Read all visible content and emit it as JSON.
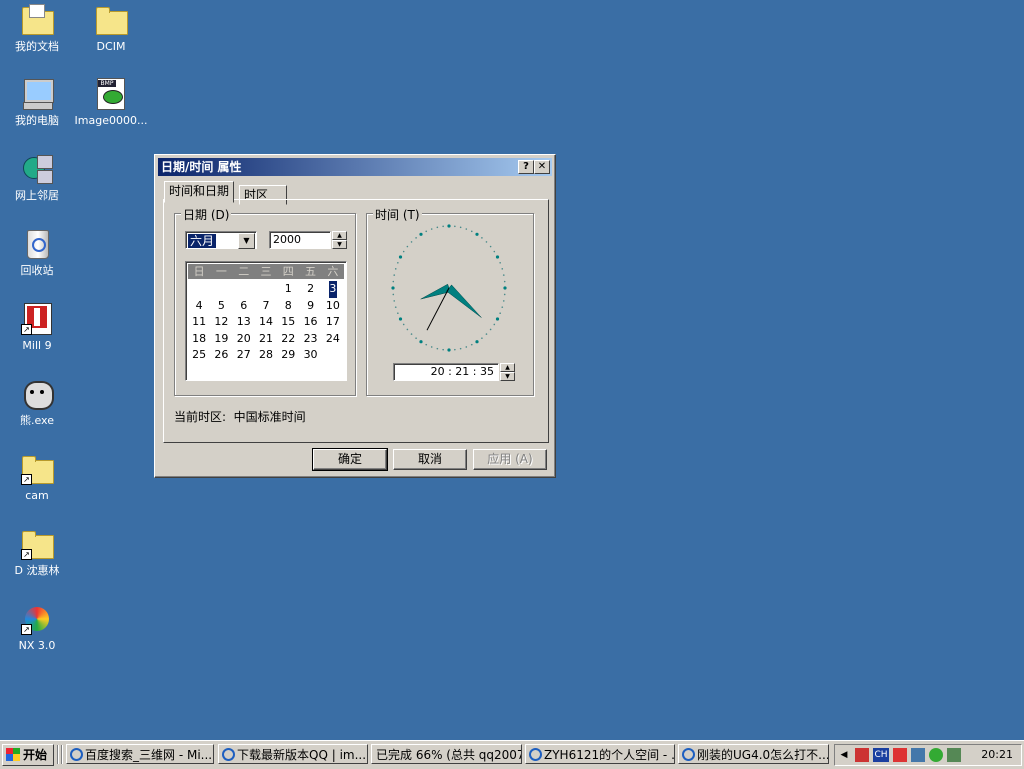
{
  "desktop": {
    "icons": [
      {
        "label": "我的文档",
        "icon": "my-documents-icon"
      },
      {
        "label": "DCIM",
        "icon": "folder-icon"
      },
      {
        "label": "我的电脑",
        "icon": "my-computer-icon"
      },
      {
        "label": "Image0000...",
        "icon": "bmp-image-icon"
      },
      {
        "label": "网上邻居",
        "icon": "network-icon"
      },
      {
        "label": "回收站",
        "icon": "recycle-bin-icon"
      },
      {
        "label": "Mill 9",
        "icon": "mill-app-icon"
      },
      {
        "label": "熊.exe",
        "icon": "bear-exe-icon"
      },
      {
        "label": "cam",
        "icon": "folder-shortcut-icon"
      },
      {
        "label": "D 沈惠林",
        "icon": "folder-shortcut-icon"
      },
      {
        "label": "NX 3.0",
        "icon": "nx-app-icon"
      }
    ]
  },
  "dialog": {
    "title": "日期/时间 属性",
    "help_glyph": "?",
    "close_glyph": "✕",
    "tabs": [
      "时间和日期",
      "时区"
    ],
    "date_group": {
      "label": "日期 (D)",
      "month": "六月",
      "year": "2000",
      "weekdays": [
        "日",
        "一",
        "二",
        "三",
        "四",
        "五",
        "六"
      ],
      "days": [
        "",
        "",
        "",
        "",
        "1",
        "2",
        "3",
        "4",
        "5",
        "6",
        "7",
        "8",
        "9",
        "10",
        "11",
        "12",
        "13",
        "14",
        "15",
        "16",
        "17",
        "18",
        "19",
        "20",
        "21",
        "22",
        "23",
        "24",
        "25",
        "26",
        "27",
        "28",
        "29",
        "30"
      ],
      "selected_day": "3"
    },
    "time_group": {
      "label": "时间 (T)",
      "time": "20 : 21 : 35",
      "hours": 20,
      "minutes": 21,
      "seconds": 35
    },
    "timezone_text": "当前时区:  中国标准时间",
    "buttons": {
      "ok": "确定",
      "cancel": "取消",
      "apply": "应用 (A)"
    }
  },
  "taskbar": {
    "start_label": "开始",
    "tasks": [
      "百度搜索_三维网 - Mi...",
      "下载最新版本QQ | im....",
      "已完成 66% (总共 qq2007...",
      "ZYH6121的个人空间 - ...",
      "刚装的UG4.0怎么打不..."
    ],
    "tray_lang": "CH",
    "clock": "20:21"
  },
  "colors": {
    "desktop": "#3a6ea5",
    "title_start": "#0a246a",
    "title_end": "#a6caf0",
    "clock_face": "#008080"
  }
}
